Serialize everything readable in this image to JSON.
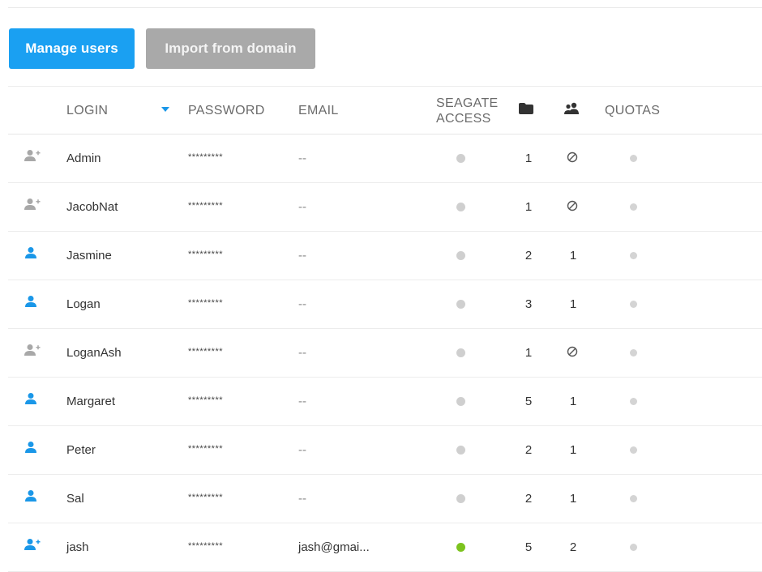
{
  "toolbar": {
    "manage_users_label": "Manage users",
    "import_label": "Import from domain"
  },
  "columns": {
    "login": "LOGIN",
    "password": "PASSWORD",
    "email": "EMAIL",
    "seagate_line1": "SEAGATE",
    "seagate_line2": "ACCESS",
    "shares_icon": "folder-icon",
    "groups_icon": "users-group-icon",
    "quotas": "QUOTAS"
  },
  "sort": {
    "column": "login",
    "icon": "sort-down-icon"
  },
  "colors": {
    "primary": "#1aa0f2",
    "secondary": "#a9a9a9",
    "access_on": "#7cc31e",
    "access_off": "#cfcfcf",
    "icon_blue": "#1a97e8",
    "icon_grey": "#a8a8a8"
  },
  "users": [
    {
      "type_icon": "user-add-icon",
      "icon_color": "grey",
      "login": "Admin",
      "password": "*********",
      "email": "--",
      "access": false,
      "shares": "1",
      "groups": "none",
      "quota": false
    },
    {
      "type_icon": "user-add-icon",
      "icon_color": "grey",
      "login": "JacobNat",
      "password": "*********",
      "email": "--",
      "access": false,
      "shares": "1",
      "groups": "none",
      "quota": false
    },
    {
      "type_icon": "user-icon",
      "icon_color": "blue",
      "login": "Jasmine",
      "password": "*********",
      "email": "--",
      "access": false,
      "shares": "2",
      "groups": "1",
      "quota": false
    },
    {
      "type_icon": "user-icon",
      "icon_color": "blue",
      "login": "Logan",
      "password": "*********",
      "email": "--",
      "access": false,
      "shares": "3",
      "groups": "1",
      "quota": false
    },
    {
      "type_icon": "user-add-icon",
      "icon_color": "grey",
      "login": "LoganAsh",
      "password": "*********",
      "email": "--",
      "access": false,
      "shares": "1",
      "groups": "none",
      "quota": false
    },
    {
      "type_icon": "user-icon",
      "icon_color": "blue",
      "login": "Margaret",
      "password": "*********",
      "email": "--",
      "access": false,
      "shares": "5",
      "groups": "1",
      "quota": false
    },
    {
      "type_icon": "user-icon",
      "icon_color": "blue",
      "login": "Peter",
      "password": "*********",
      "email": "--",
      "access": false,
      "shares": "2",
      "groups": "1",
      "quota": false
    },
    {
      "type_icon": "user-icon",
      "icon_color": "blue",
      "login": "Sal",
      "password": "*********",
      "email": "--",
      "access": false,
      "shares": "2",
      "groups": "1",
      "quota": false
    },
    {
      "type_icon": "user-add-icon",
      "icon_color": "blue",
      "login": "jash",
      "password": "*********",
      "email": "jash@gmai...",
      "access": true,
      "shares": "5",
      "groups": "2",
      "quota": false
    }
  ]
}
